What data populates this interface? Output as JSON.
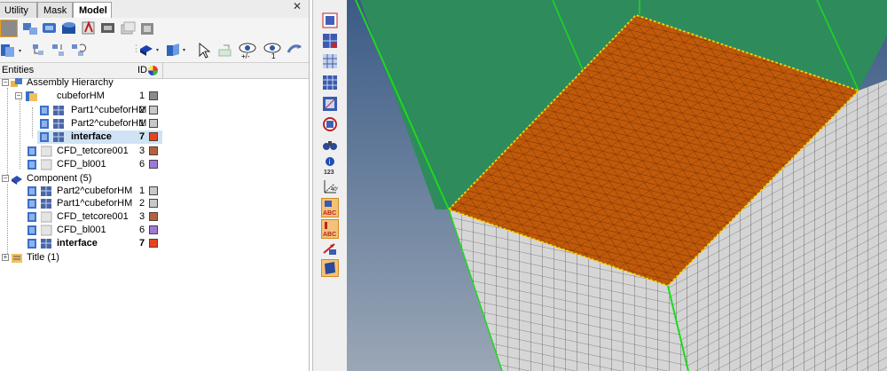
{
  "tabs": [
    {
      "label": "Utility",
      "active": false
    },
    {
      "label": "Mask",
      "active": false
    },
    {
      "label": "Model",
      "active": true
    }
  ],
  "header": {
    "entities": "Entities",
    "id": "ID"
  },
  "tree": [
    {
      "label": "Assembly Hierarchy",
      "id": "",
      "color": "",
      "bold": false
    },
    {
      "label": "cubeforHM",
      "id": "1",
      "color": "#8c8c8c",
      "bold": false
    },
    {
      "label": "Part1^cubeforHM",
      "id": "2",
      "color": "#c8c8c8",
      "bold": false
    },
    {
      "label": "Part2^cubeforHM",
      "id": "1",
      "color": "#c8c8c8",
      "bold": false
    },
    {
      "label": "interface",
      "id": "7",
      "color": "#e8431f",
      "bold": true
    },
    {
      "label": "CFD_tetcore001",
      "id": "3",
      "color": "#b8603c",
      "bold": false
    },
    {
      "label": "CFD_bl001",
      "id": "6",
      "color": "#9f79d9",
      "bold": false
    },
    {
      "label": "Component (5)",
      "id": "",
      "color": "",
      "bold": false
    },
    {
      "label": "Part2^cubeforHM",
      "id": "1",
      "color": "#c8c8c8",
      "bold": false
    },
    {
      "label": "Part1^cubeforHM",
      "id": "2",
      "color": "#c8c8c8",
      "bold": false
    },
    {
      "label": "CFD_tetcore001",
      "id": "3",
      "color": "#b8603c",
      "bold": false
    },
    {
      "label": "CFD_bl001",
      "id": "6",
      "color": "#9f79d9",
      "bold": false
    },
    {
      "label": "interface",
      "id": "7",
      "color": "#e8431f",
      "bold": true
    },
    {
      "label": "Title (1)",
      "id": "",
      "color": "",
      "bold": false
    }
  ],
  "left_toolbar_icons": [
    "component-view-icon",
    "assembly-icon",
    "property-icon",
    "material-icon",
    "load-collector-icon",
    "model-browser-icon",
    "part-icon",
    "part-filter-icon",
    "import-icon",
    "organize-icon",
    "display-mode-icon",
    "color-by-icon",
    "pointer-icon",
    "edit-icon",
    "visibility-plus-icon",
    "visibility-one-icon",
    "revert-icon"
  ],
  "right_toolbar_icons": [
    "mesh-shade-icon",
    "mesh-check-icon",
    "element-edit-icon",
    "plane-grid-icon",
    "surface-icon",
    "zone-icon",
    "binoculars-icon",
    "info-123-icon",
    "axis-icon",
    "label-abc-icon",
    "label-abc-red-icon",
    "vector-icon",
    "panel-view-icon"
  ],
  "colors": {
    "top_face": "#c05a0a",
    "side_mesh": "#d6d6d6",
    "green_fluid": "#2e8c5c",
    "edge_green": "#1ed81e",
    "background_top": "#3b5b86",
    "background_bottom": "#9aa7b6"
  }
}
